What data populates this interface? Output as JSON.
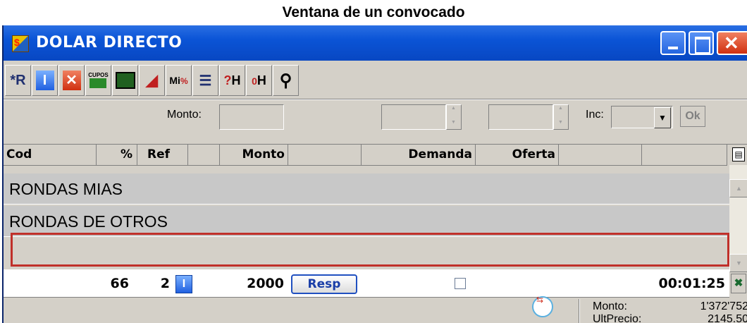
{
  "page_title": "Ventana de un convocado",
  "window": {
    "title": "DOLAR DIRECTO",
    "app_icon": "dolar-directo-app-icon",
    "controls": [
      "minimize",
      "maximize",
      "close"
    ]
  },
  "toolbar": {
    "buttons": [
      {
        "name": "refresh-r-icon",
        "glyph": "*R"
      },
      {
        "name": "info-icon",
        "glyph": "I"
      },
      {
        "name": "cancel-icon",
        "glyph": "✕"
      },
      {
        "name": "cupos-icon",
        "glyph": "CUPOS"
      },
      {
        "name": "windows-icon",
        "glyph": "⧉"
      },
      {
        "name": "chart-icon",
        "glyph": "▲"
      },
      {
        "name": "mi-percent-icon",
        "glyph": "Mi%"
      },
      {
        "name": "list-icon",
        "glyph": "☰"
      },
      {
        "name": "question-h-icon",
        "glyph": "?H"
      },
      {
        "name": "zero-h-icon",
        "glyph": "₀H"
      },
      {
        "name": "search-settings-icon",
        "glyph": "⚲"
      }
    ]
  },
  "controls": {
    "monto_label": "Monto:",
    "inc_label": "Inc:",
    "ok_label": "Ok"
  },
  "grid": {
    "columns": [
      "Cod",
      "%",
      "Ref",
      "Monto",
      "Demanda",
      "Oferta"
    ],
    "groups": [
      "RONDAS MIAS",
      "RONDAS DE OTROS"
    ],
    "row": {
      "pct": "66",
      "ref": "2",
      "info": "I",
      "monto": "2000",
      "action": "Resp",
      "oferta_time": "00:01:25"
    }
  },
  "status": {
    "monto_label": "Monto:",
    "monto_value": "1'372'752",
    "ultprecio_label": "UltPrecio:",
    "ultprecio_value": "2145.50"
  }
}
